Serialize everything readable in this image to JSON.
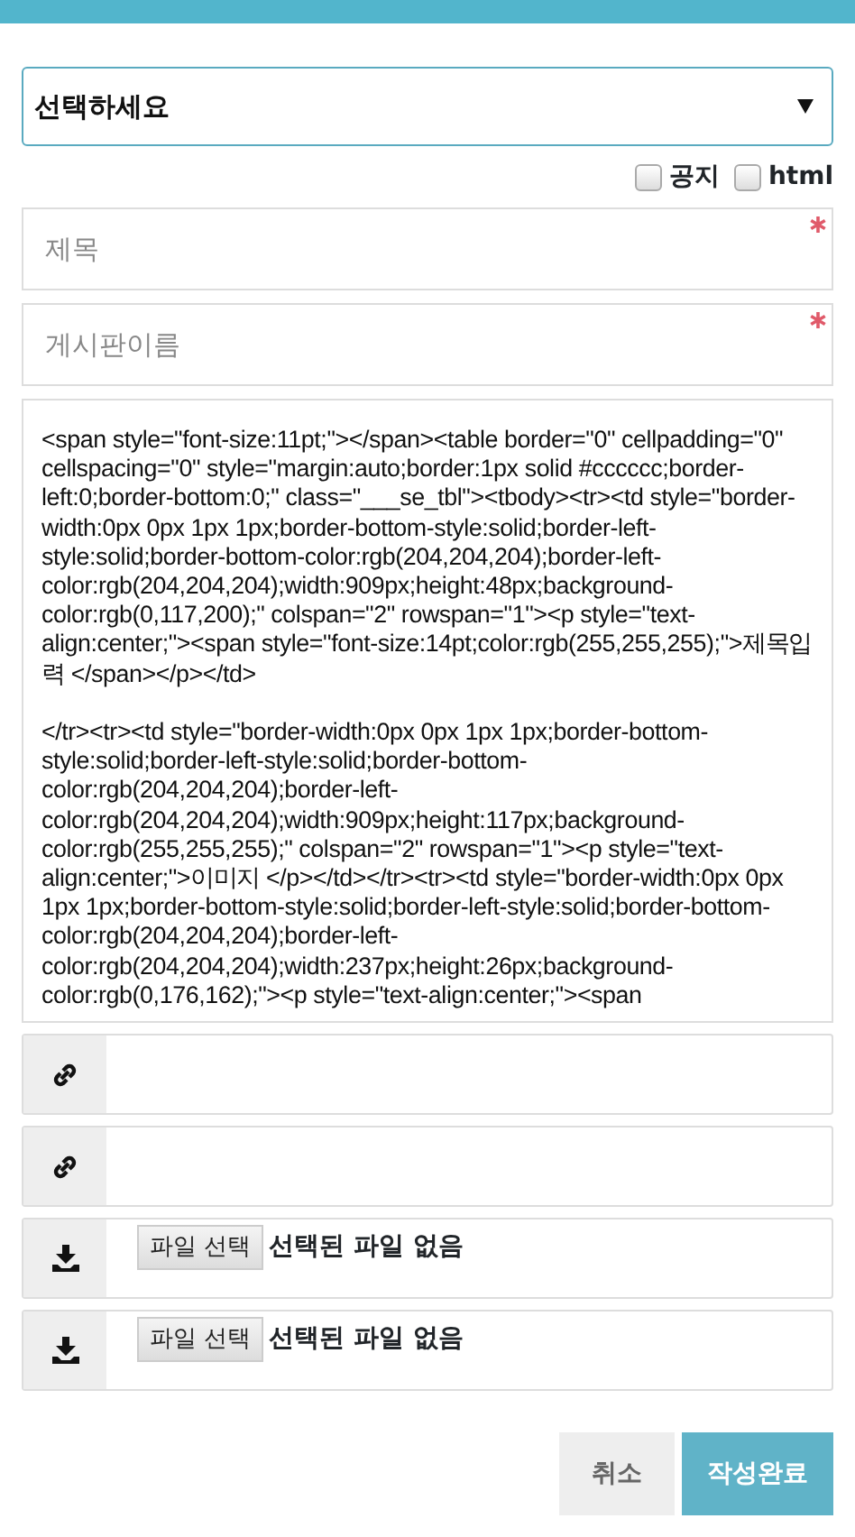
{
  "category_select": {
    "value": "선택하세요"
  },
  "options": [
    {
      "label": "공지",
      "checked": false
    },
    {
      "label": "html",
      "checked": false
    }
  ],
  "fields": [
    {
      "placeholder": "제목",
      "required": true
    },
    {
      "placeholder": "게시판이름",
      "required": true
    }
  ],
  "editor": {
    "value": "<span style=\"font-size:11pt;\"></span><table border=\"0\" cellpadding=\"0\" cellspacing=\"0\" style=\"margin:auto;border:1px solid #cccccc;border-left:0;border-bottom:0;\" class=\"___se_tbl\"><tbody><tr><td style=\"border-width:0px 0px 1px 1px;border-bottom-style:solid;border-left-style:solid;border-bottom-color:rgb(204,204,204);border-left-color:rgb(204,204,204);width:909px;height:48px;background-color:rgb(0,117,200);\" colspan=\"2\" rowspan=\"1\"><p style=\"text-align:center;\"><span style=\"font-size:14pt;color:rgb(255,255,255);\">제목입력 </span></p></td>\n\n</tr><tr><td style=\"border-width:0px 0px 1px 1px;border-bottom-style:solid;border-left-style:solid;border-bottom-color:rgb(204,204,204);border-left-color:rgb(204,204,204);width:909px;height:117px;background-color:rgb(255,255,255);\" colspan=\"2\" rowspan=\"1\"><p style=\"text-align:center;\">이미지 </p></td></tr><tr><td style=\"border-width:0px 0px 1px 1px;border-bottom-style:solid;border-left-style:solid;border-bottom-color:rgb(204,204,204);border-left-color:rgb(204,204,204);width:237px;height:26px;background-color:rgb(0,176,162);\"><p style=\"text-align:center;\"><span"
  },
  "attachments": [
    {
      "kind": "link"
    },
    {
      "kind": "link"
    },
    {
      "kind": "file",
      "button": "파일 선택",
      "status": "선택된 파일 없음"
    },
    {
      "kind": "file",
      "button": "파일 선택",
      "status": "선택된 파일 없음"
    }
  ],
  "buttons": [
    {
      "label": "취소",
      "kind": "secondary"
    },
    {
      "label": "작성완료",
      "kind": "primary"
    }
  ]
}
